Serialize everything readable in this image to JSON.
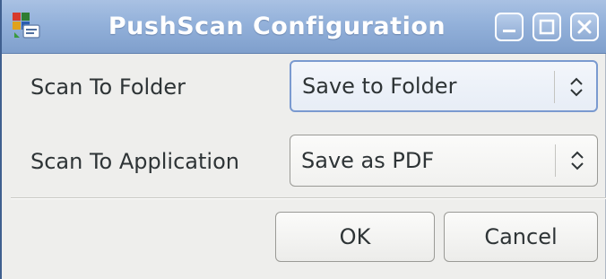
{
  "window": {
    "title": "PushScan Configuration",
    "app_icon": "pushscan-app-icon",
    "controls": {
      "minimize_icon": "minimize-icon",
      "maximize_icon": "maximize-icon",
      "close_icon": "close-icon"
    },
    "colors": {
      "titlebar": "#93b1da",
      "window_bg": "#eeeeec",
      "text": "#2e3436"
    }
  },
  "form": {
    "scan_to_folder": {
      "label": "Scan To Folder",
      "selected": "Save to Folder",
      "icon": "updown-chevron-icon"
    },
    "scan_to_application": {
      "label": "Scan To Application",
      "selected": "Save as PDF",
      "icon": "updown-chevron-icon"
    }
  },
  "buttons": {
    "ok": "OK",
    "cancel": "Cancel"
  }
}
